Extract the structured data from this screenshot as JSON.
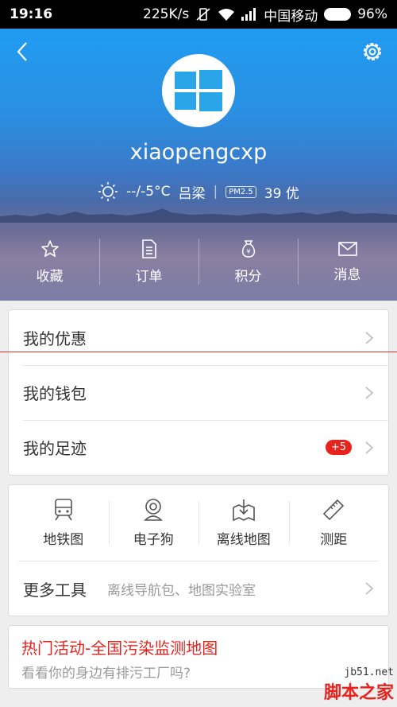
{
  "status_bar": {
    "time": "19:16",
    "speed": "225K/s",
    "carrier": "中国移动",
    "battery": "96%"
  },
  "profile": {
    "username": "xiaopengcxp",
    "weather": {
      "temp": "--/-5°C",
      "city": "吕梁",
      "pm_label": "PM2.5",
      "aqi": "39 优"
    }
  },
  "quick_actions": [
    {
      "label": "收藏",
      "icon": "star-icon"
    },
    {
      "label": "订单",
      "icon": "document-icon"
    },
    {
      "label": "积分",
      "icon": "money-bag-icon"
    },
    {
      "label": "消息",
      "icon": "envelope-icon"
    }
  ],
  "account_rows": [
    {
      "label": "我的优惠"
    },
    {
      "label": "我的钱包"
    },
    {
      "label": "我的足迹",
      "badge": "+5"
    }
  ],
  "tools": [
    {
      "label": "地铁图",
      "icon": "subway-icon"
    },
    {
      "label": "电子狗",
      "icon": "camera-icon"
    },
    {
      "label": "离线地图",
      "icon": "download-map-icon"
    },
    {
      "label": "测距",
      "icon": "ruler-icon"
    }
  ],
  "more_tools": {
    "title": "更多工具",
    "subtitle": "离线导航包、地图实验室"
  },
  "promo": {
    "title": "热门活动-全国污染监测地图",
    "subtitle": "看看你的身边有排污工厂吗?"
  },
  "watermark": {
    "url": "jb51.net",
    "name": "脚本之家"
  },
  "colors": {
    "accent_red": "#e8221c",
    "header_blue": "#1f9cf2"
  }
}
